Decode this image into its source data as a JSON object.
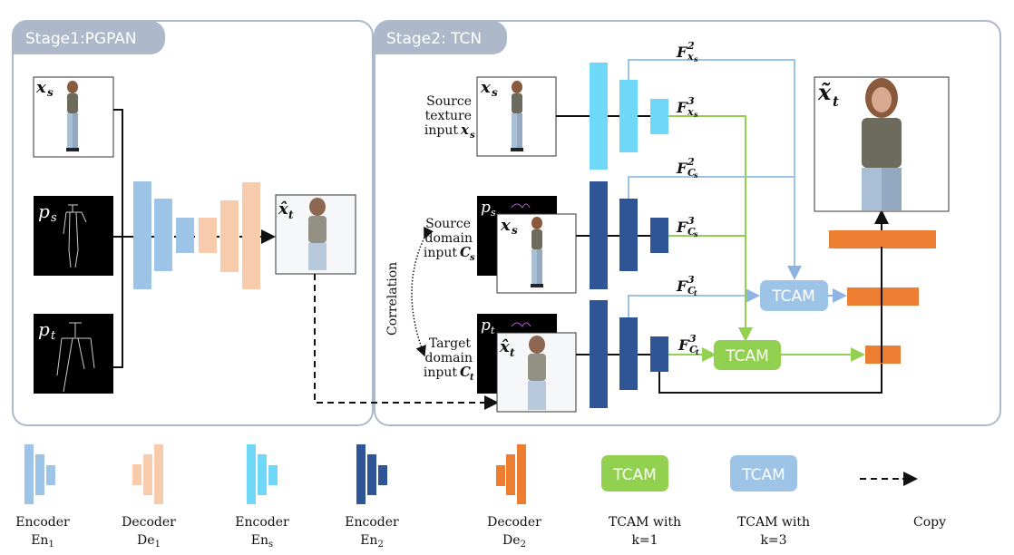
{
  "stage1": {
    "title": "Stage1:PGPAN"
  },
  "stage2": {
    "title": "Stage2: TCN"
  },
  "stage1_inputs": {
    "xs": "x",
    "xs_sub": "s",
    "ps": "p",
    "ps_sub": "s",
    "pt": "p",
    "pt_sub": "t"
  },
  "stage1_output": {
    "symbol": "x̂",
    "sub": "t"
  },
  "stage2_inputs": {
    "texture_label": [
      "Source",
      "texture",
      "input"
    ],
    "texture_symbol": "x",
    "texture_sub": "s",
    "source_domain_label": [
      "Source",
      "domain",
      "input"
    ],
    "source_domain_symbol": "C",
    "source_domain_sub": "s",
    "target_domain_label": [
      "Target",
      "domain",
      "input"
    ],
    "target_domain_symbol": "C",
    "target_domain_sub": "t",
    "correlation": "Correlation"
  },
  "features": {
    "f2_xs": {
      "base": "F",
      "sup": "2",
      "sub": "x",
      "subsub": "s"
    },
    "f3_xs": {
      "base": "F",
      "sup": "3",
      "sub": "x",
      "subsub": "s"
    },
    "f2_cs": {
      "base": "F",
      "sup": "2",
      "sub": "C",
      "subsub": "s"
    },
    "f3_cs": {
      "base": "F",
      "sup": "3",
      "sub": "C",
      "subsub": "s"
    },
    "f3_ct_top": {
      "base": "F",
      "sup": "3",
      "sub": "C",
      "subsub": "t"
    },
    "f3_ct_bot": {
      "base": "F",
      "sup": "3",
      "sub": "C",
      "subsub": "t"
    }
  },
  "tcam": {
    "label": "TCAM"
  },
  "final_output": {
    "symbol": "x̃",
    "sub": "t"
  },
  "colors": {
    "en1": "#9dc3e6",
    "de1": "#f8cbad",
    "ens": "#6fd7f7",
    "en2": "#2f5597",
    "de2": "#ed7d31",
    "tcam_k1": "#92d050",
    "tcam_k3": "#9dc3e6",
    "stage_border": "#adb9ca",
    "green_line": "#92d050",
    "blue_line": "#9dc3e6"
  },
  "legend": [
    {
      "name": "Encoder",
      "sub_base": "En",
      "sub": "1"
    },
    {
      "name": "Decoder",
      "sub_base": "De",
      "sub": "1"
    },
    {
      "name": "Encoder",
      "sub_base": "En",
      "sub": "s"
    },
    {
      "name": "Encoder",
      "sub_base": "En",
      "sub": "2"
    },
    {
      "name": "Decoder",
      "sub_base": "De",
      "sub": "2"
    },
    {
      "name": "TCAM with",
      "sub_base": "k=1",
      "sub": ""
    },
    {
      "name": "TCAM with",
      "sub_base": "k=3",
      "sub": ""
    },
    {
      "name": "Copy",
      "sub_base": "",
      "sub": ""
    }
  ]
}
